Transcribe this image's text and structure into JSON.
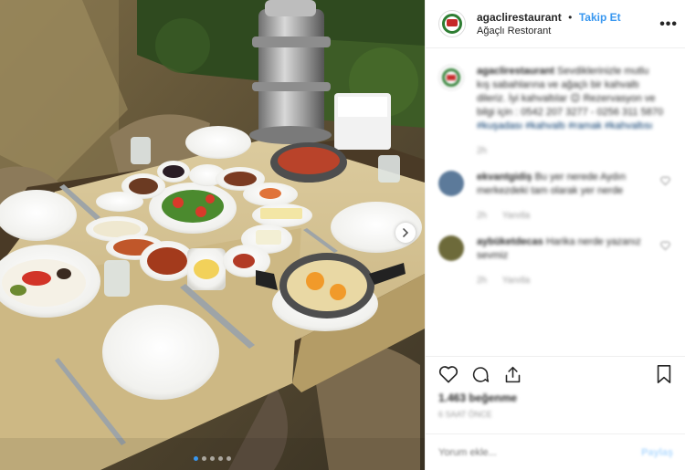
{
  "header": {
    "username": "agaclirestaurant",
    "separator": "•",
    "follow_label": "Takip Et",
    "location": "Ağaçlı Restorant",
    "more_icon": "more-horizontal-icon"
  },
  "carousel": {
    "total_slides": 5,
    "active_slide": 1,
    "next_icon": "chevron-right-icon",
    "active_dot_color": "#3897f0"
  },
  "comments": [
    {
      "username": "agaclirestaurant",
      "text": "Sevdiklerinizle mutlu kış sabahlarına ve ağaçlı bir kahvaltı dileriz. İyi kahvaltılar 😊 Rezervasyon ve bilgi için : 0542 207 3277 - 0256 311 5870",
      "tags": "#kuşadası #kahvaltı #ramak #kahvaltısı",
      "time": "2h",
      "reply_label": "",
      "has_heart": false,
      "avatar_color": "#c62828"
    },
    {
      "username": "ekvantgidiş",
      "text": "Bu yer nerede Aydın merkezdeki tam olarak yer nerde",
      "tags": "",
      "time": "2h",
      "reply_label": "Yanıtla",
      "has_heart": true,
      "avatar_color": "#5c7a9a"
    },
    {
      "username": "aybüketdecas",
      "text": "Harika nerde yazanız sevmiz",
      "tags": "",
      "time": "2h",
      "reply_label": "Yanıtla",
      "has_heart": true,
      "avatar_color": "#6d6a3a"
    }
  ],
  "actions": {
    "like_icon": "heart-icon",
    "comment_icon": "comment-icon",
    "share_icon": "share-icon",
    "save_icon": "bookmark-icon",
    "likes_text": "1.463 beğenme",
    "time_ago": "6 saat önce"
  },
  "comment_box": {
    "placeholder": "Yorum ekle...",
    "share_label": "Paylaş"
  }
}
